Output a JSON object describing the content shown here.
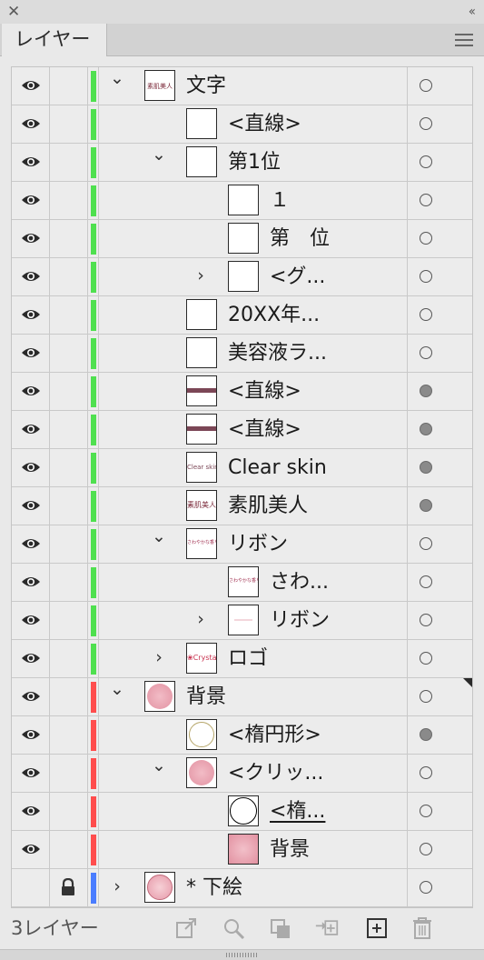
{
  "panel": {
    "tab_label": "レイヤー"
  },
  "colors": {
    "green": "#4fe04f",
    "red": "#ff4d4d",
    "blue": "#4a7dff"
  },
  "layers": [
    {
      "name": "文字",
      "indent": 0,
      "expander": "open",
      "thumb": "sohada-text",
      "color": "green",
      "target": "empty"
    },
    {
      "name": "<直線>",
      "indent": 1,
      "expander": "none",
      "thumb": "blank",
      "color": "green",
      "target": "empty"
    },
    {
      "name": "第1位",
      "indent": 1,
      "expander": "open",
      "thumb": "blank",
      "color": "green",
      "target": "empty"
    },
    {
      "name": "１",
      "indent": 2,
      "expander": "none",
      "thumb": "blank",
      "color": "green",
      "target": "empty"
    },
    {
      "name": "第　位",
      "indent": 2,
      "expander": "none",
      "thumb": "blank",
      "color": "green",
      "target": "empty"
    },
    {
      "name": "<グ...",
      "indent": 2,
      "expander": "closed",
      "thumb": "blank",
      "color": "green",
      "target": "empty"
    },
    {
      "name": "20XX年...",
      "indent": 1,
      "expander": "none",
      "thumb": "blank",
      "color": "green",
      "target": "empty"
    },
    {
      "name": "美容液ラ...",
      "indent": 1,
      "expander": "none",
      "thumb": "blank",
      "color": "green",
      "target": "empty"
    },
    {
      "name": "<直線>",
      "indent": 1,
      "expander": "none",
      "thumb": "line",
      "color": "green",
      "target": "filled"
    },
    {
      "name": "<直線>",
      "indent": 1,
      "expander": "none",
      "thumb": "line",
      "color": "green",
      "target": "filled"
    },
    {
      "name": "Clear skin",
      "indent": 1,
      "expander": "none",
      "thumb": "clearskin",
      "color": "green",
      "target": "filled"
    },
    {
      "name": "素肌美人",
      "indent": 1,
      "expander": "none",
      "thumb": "sohada",
      "color": "green",
      "target": "filled"
    },
    {
      "name": "リボン",
      "indent": 1,
      "expander": "open",
      "thumb": "arc",
      "color": "green",
      "target": "empty"
    },
    {
      "name": "さわ...",
      "indent": 2,
      "expander": "none",
      "thumb": "arc",
      "color": "green",
      "target": "empty"
    },
    {
      "name": "リボン",
      "indent": 2,
      "expander": "closed",
      "thumb": "faint",
      "color": "green",
      "target": "empty"
    },
    {
      "name": "ロゴ",
      "indent": 1,
      "expander": "closed",
      "thumb": "crystal",
      "color": "green",
      "target": "empty"
    },
    {
      "name": "背景",
      "indent": 0,
      "expander": "open",
      "thumb": "pink-circle",
      "color": "red",
      "target": "empty",
      "corner": true
    },
    {
      "name": "<楕円形>",
      "indent": 1,
      "expander": "none",
      "thumb": "ellipse",
      "color": "red",
      "target": "filled"
    },
    {
      "name": "<クリッ...",
      "indent": 1,
      "expander": "open",
      "thumb": "pink-circle",
      "color": "red",
      "target": "empty"
    },
    {
      "name": "<楕...",
      "indent": 2,
      "expander": "none",
      "thumb": "black-circle",
      "color": "red",
      "target": "empty",
      "underline": true
    },
    {
      "name": "背景",
      "indent": 2,
      "expander": "none",
      "thumb": "pink-square",
      "color": "red",
      "target": "empty"
    },
    {
      "name": "* 下絵",
      "indent": 0,
      "expander": "closed",
      "thumb": "sketch",
      "color": "blue",
      "target": "empty",
      "locked": true,
      "hidden_eye": true
    }
  ],
  "thumb_text": {
    "sohada": "素肌美人",
    "clearskin": "Clear skin",
    "crystal": "Crystal",
    "arc": "さわやかな香り"
  },
  "footer": {
    "count": "3レイヤー"
  },
  "icons": {
    "close": "close-icon",
    "collapse": "collapse-icon",
    "menu": "panel-menu-icon",
    "eye": "eye-icon",
    "lock": "lock-icon",
    "export": "collect-export-icon",
    "search": "locate-object-icon",
    "clip": "clipping-mask-icon",
    "sublayer": "new-sublayer-icon",
    "newlayer": "new-layer-icon",
    "trash": "trash-icon"
  }
}
